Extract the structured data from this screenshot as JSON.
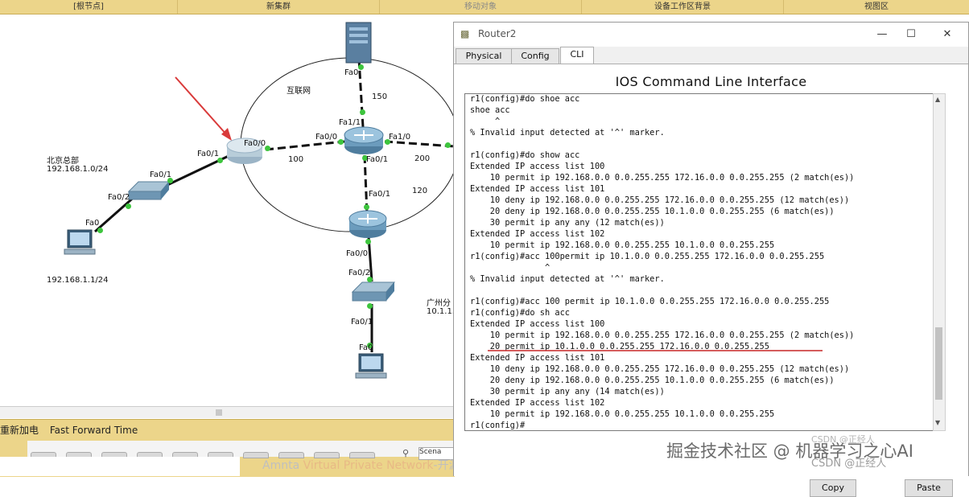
{
  "topbar": {
    "root_node": "[根节点]",
    "new_cluster": "新集群",
    "move_object": "移动对象",
    "device_bg": "设备工作区背景",
    "viewport": "视图区"
  },
  "topology": {
    "cloud_label": "互联网",
    "bj_name": "北京总部",
    "bj_subnet": "192.168.1.0/24",
    "bj_pc_ip": "192.168.1.1/24",
    "gz_name": "广州分",
    "gz_subnet": "10.1.1.",
    "links": {
      "l150": "150",
      "l100": "100",
      "l200": "200",
      "l120": "120"
    },
    "ports": {
      "server_fa0": "Fa0",
      "core_fa11": "Fa1/1",
      "core_fa00": "Fa0/0",
      "core_fa10": "Fa1/0",
      "core_fa01": "Fa0/1",
      "r1_fa00": "Fa0/0",
      "r1_fa01": "Fa0/1",
      "bjsw_fa01": "Fa0/1",
      "bjsw_fa02": "Fa0/2",
      "bjpc_fa0": "Fa0",
      "gzr_fa01": "Fa0/1",
      "gzr_fa00": "Fa0/0",
      "gzsw_fa02": "Fa0/2",
      "gzsw_fa01": "Fa0/1",
      "gzpc_fa0": "Fa0"
    }
  },
  "bottom": {
    "new_item": "重新加电",
    "fast_forward": "Fast Forward Time",
    "search_value": "Scena",
    "vpn_a": "Amnta ",
    "vpn_b": "Virtual Private Network",
    "vpn_c": "-开源"
  },
  "window": {
    "title": "Router2",
    "tabs": [
      "Physical",
      "Config",
      "CLI"
    ],
    "active_tab": "CLI",
    "heading": "IOS Command Line Interface",
    "copy_label": "Copy",
    "paste_label": "Paste",
    "cli_lines": [
      "r1(config)#do shoe acc",
      "shoe acc",
      "     ^",
      "% Invalid input detected at '^' marker.",
      "",
      "r1(config)#do show acc",
      "Extended IP access list 100",
      "    10 permit ip 192.168.0.0 0.0.255.255 172.16.0.0 0.0.255.255 (2 match(es))",
      "Extended IP access list 101",
      "    10 deny ip 192.168.0.0 0.0.255.255 172.16.0.0 0.0.255.255 (12 match(es))",
      "    20 deny ip 192.168.0.0 0.0.255.255 10.1.0.0 0.0.255.255 (6 match(es))",
      "    30 permit ip any any (12 match(es))",
      "Extended IP access list 102",
      "    10 permit ip 192.168.0.0 0.0.255.255 10.1.0.0 0.0.255.255",
      "r1(config)#acc 100permit ip 10.1.0.0 0.0.255.255 172.16.0.0 0.0.255.255",
      "               ^",
      "% Invalid input detected at '^' marker.",
      "",
      "r1(config)#acc 100 permit ip 10.1.0.0 0.0.255.255 172.16.0.0 0.0.255.255",
      "r1(config)#do sh acc",
      "Extended IP access list 100",
      "    10 permit ip 192.168.0.0 0.0.255.255 172.16.0.0 0.0.255.255 (2 match(es))",
      "    20 permit ip 10.1.0.0 0.0.255.255 172.16.0.0 0.0.255.255",
      "Extended IP access list 101",
      "    10 deny ip 192.168.0.0 0.0.255.255 172.16.0.0 0.0.255.255 (12 match(es))",
      "    20 deny ip 192.168.0.0 0.0.255.255 10.1.0.0 0.0.255.255 (6 match(es))",
      "    30 permit ip any any (14 match(es))",
      "Extended IP access list 102",
      "    10 permit ip 192.168.0.0 0.0.255.255 10.1.0.0 0.0.255.255",
      "r1(config)#"
    ]
  },
  "watermarks": {
    "juejin": "掘金技术社区 @ 机器学习之心AI",
    "csdn1": "CSDN @正经人",
    "csdn2": "CSDN @正经人"
  },
  "colors": {
    "accent_yellow": "#ecd58a",
    "link_green": "#3ec53e",
    "annotation_red": "#d93a3a",
    "underline_red": "#c72626"
  }
}
